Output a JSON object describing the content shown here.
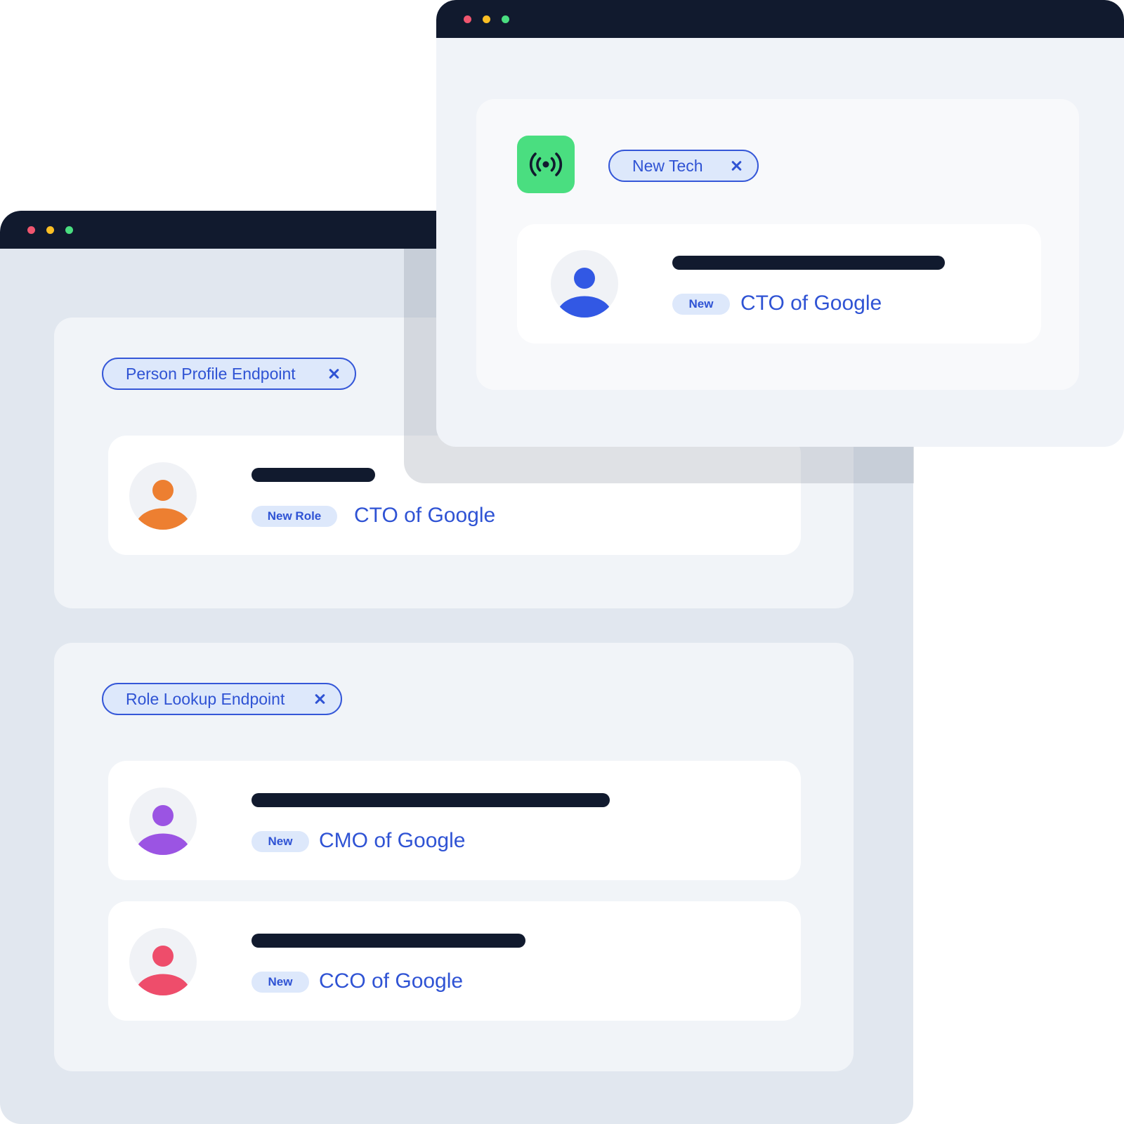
{
  "colors": {
    "titlebar": "#111a2e",
    "accent": "#2f53d4",
    "chip_bg": "#dde8fb",
    "dot_red": "#f0566f",
    "dot_yellow": "#fbbf24",
    "dot_green": "#4ade80",
    "app_icon_bg": "#4ade80"
  },
  "back_window": {
    "person_profile": {
      "chip_label": "Person Profile Endpoint",
      "card": {
        "badge": "New Role",
        "role": "CTO of Google",
        "avatar_color": "#ed7f31"
      }
    },
    "role_lookup": {
      "chip_label": "Role Lookup Endpoint",
      "cards": [
        {
          "badge": "New",
          "role": "CMO of Google",
          "avatar_color": "#9b54e3"
        },
        {
          "badge": "New",
          "role": "CCO of Google",
          "avatar_color": "#ee4d6b"
        }
      ]
    }
  },
  "front_window": {
    "app_icon": "broadcast-signal-icon",
    "chip_label": "New Tech",
    "card": {
      "badge": "New",
      "role": "CTO of Google",
      "avatar_color": "#3258e4"
    }
  }
}
